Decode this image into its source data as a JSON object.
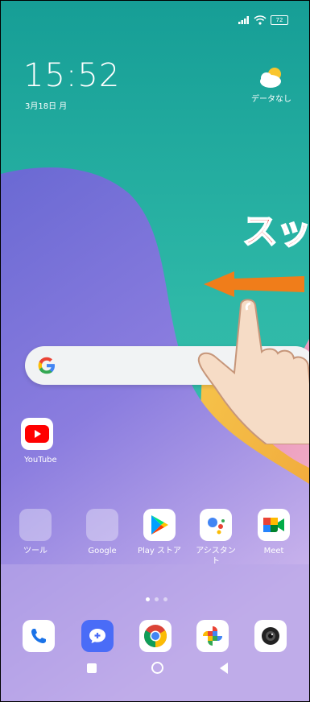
{
  "status_bar": {
    "battery": "72"
  },
  "clock": {
    "time": "15:52",
    "date": "3月18日 月"
  },
  "weather": {
    "label": "データなし"
  },
  "overlay": {
    "text": "スッ"
  },
  "folders": [
    {
      "label": "ツール"
    },
    {
      "label": "Google"
    }
  ],
  "apps": {
    "youtube": "YouTube",
    "play_store": "Play ストア",
    "assistant": "アシスタン ト",
    "meet": "Meet"
  },
  "colors": {
    "accent_red": "#e21d1d",
    "arrow_orange": "#f07d1a",
    "wallpaper_top": "#17a79a",
    "wallpaper_purple": "#7f6ad9"
  }
}
